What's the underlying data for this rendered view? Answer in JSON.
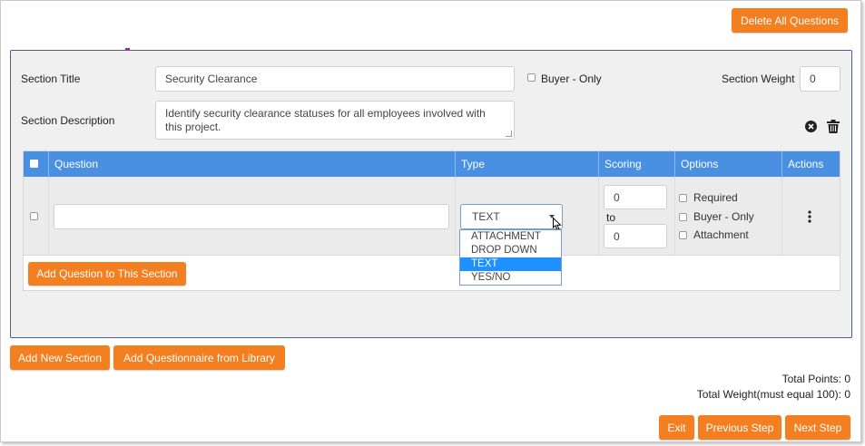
{
  "header": {
    "delete_all_label": "Delete All Questions"
  },
  "section": {
    "title_label": "Section Title",
    "title_value": "Security Clearance",
    "buyer_only_label": "Buyer - Only",
    "weight_label": "Section Weight",
    "weight_value": "0",
    "description_label": "Section Description",
    "description_value": "Identify security clearance statuses for all employees involved with this project."
  },
  "table": {
    "headers": {
      "question": "Question",
      "type": "Type",
      "scoring": "Scoring",
      "options": "Options",
      "actions": "Actions"
    },
    "row": {
      "question_value": "",
      "type_selected": "TEXT",
      "type_options": [
        "ATTACHMENT",
        "DROP DOWN",
        "TEXT",
        "YES/NO"
      ],
      "score_min": "0",
      "score_to_label": "to",
      "score_max": "0",
      "options": {
        "required": "Required",
        "buyer_only": "Buyer - Only",
        "attachment": "Attachment"
      }
    },
    "add_question_label": "Add Question to This Section"
  },
  "footer": {
    "add_section_label": "Add New Section",
    "add_library_label": "Add Questionnaire from Library",
    "total_points_label": "Total Points:",
    "total_points_value": "0",
    "total_weight_label": "Total Weight(must equal 100):",
    "total_weight_value": "0",
    "exit_label": "Exit",
    "previous_label": "Previous Step",
    "next_label": "Next Step"
  },
  "colors": {
    "accent": "#f47f20",
    "table_header": "#4a90e2",
    "panel_border": "#4d5a9e",
    "selected_option": "#1e90ff"
  }
}
